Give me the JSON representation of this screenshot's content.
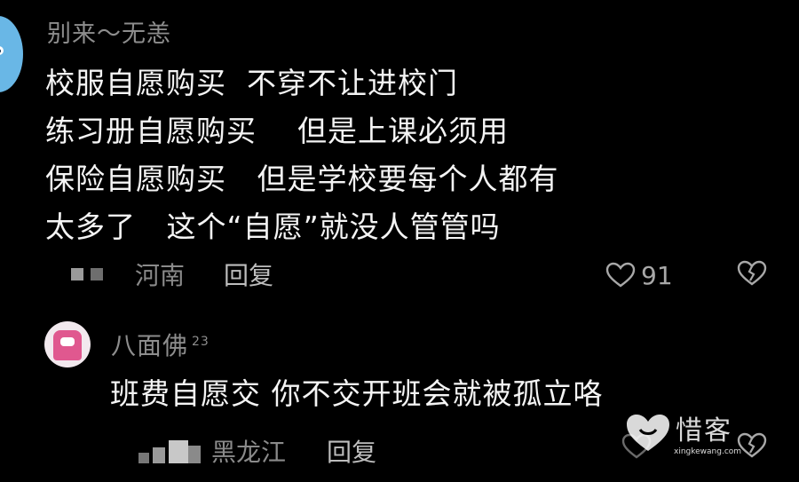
{
  "comment1": {
    "username": "别来～无恙",
    "body_lines": [
      "校服自愿购买  不穿不让进校门",
      "练习册自愿购买    但是上课必须用",
      "保险自愿购买   但是学校要每个人都有",
      "太多了   这个“自愿”就没人管管吗"
    ],
    "location": "河南",
    "reply_label": "回复",
    "like_count": "91"
  },
  "comment2": {
    "username": "八面佛",
    "badge": "23",
    "body": "班费自愿交 你不交开班会就被孤立咯",
    "location": "黑龙江",
    "reply_label": "回复"
  },
  "watermark": {
    "text": "惜客",
    "sub": "xingkewang.com"
  },
  "colors": {
    "background": "#000000",
    "text_primary": "#f4f4f4",
    "text_secondary": "#8d8d8d"
  }
}
